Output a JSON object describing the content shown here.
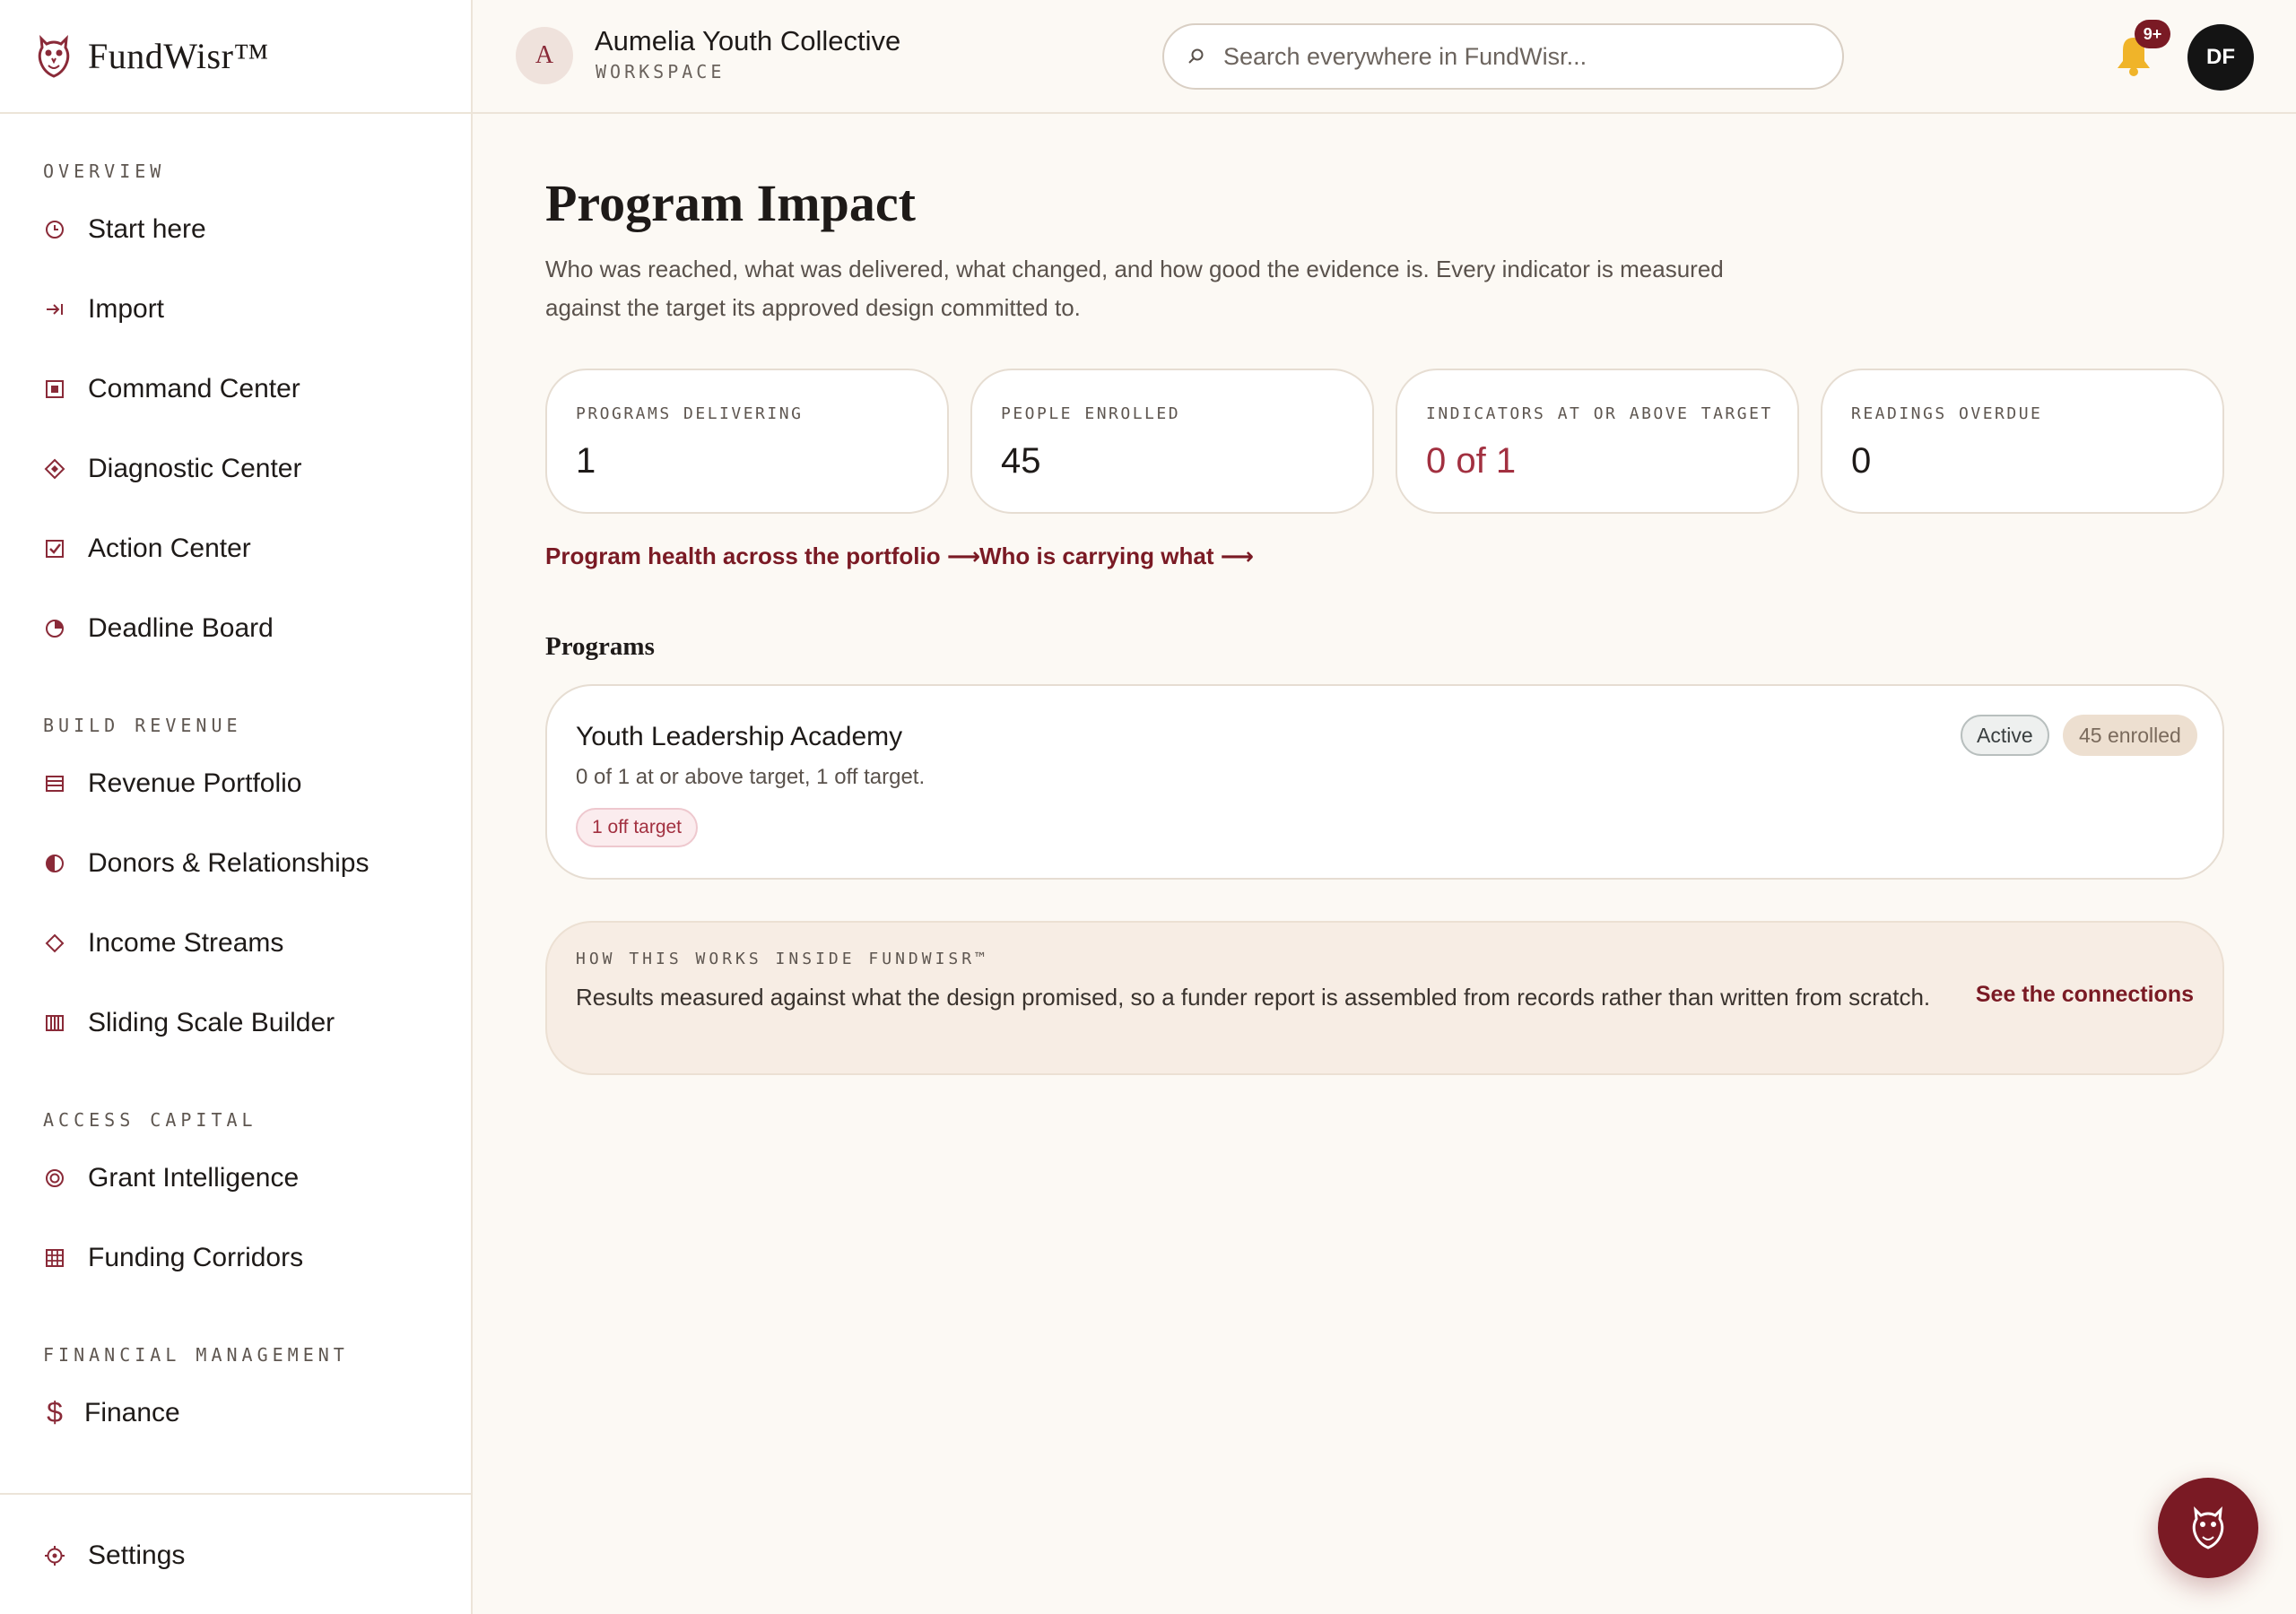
{
  "brand": {
    "name": "FundWisr™"
  },
  "sidebar": {
    "sections": [
      {
        "title": "OVERVIEW",
        "items": [
          {
            "label": "Start here"
          },
          {
            "label": "Import"
          },
          {
            "label": "Command Center"
          },
          {
            "label": "Diagnostic Center"
          },
          {
            "label": "Action Center"
          },
          {
            "label": "Deadline Board"
          }
        ]
      },
      {
        "title": "BUILD REVENUE",
        "items": [
          {
            "label": "Revenue Portfolio"
          },
          {
            "label": "Donors & Relationships"
          },
          {
            "label": "Income Streams"
          },
          {
            "label": "Sliding Scale Builder"
          }
        ]
      },
      {
        "title": "ACCESS CAPITAL",
        "items": [
          {
            "label": "Grant Intelligence"
          },
          {
            "label": "Funding Corridors"
          }
        ]
      },
      {
        "title": "FINANCIAL MANAGEMENT",
        "items": [
          {
            "label": "Finance"
          }
        ]
      }
    ],
    "settings_label": "Settings"
  },
  "header": {
    "workspace_initial": "A",
    "workspace_name": "Aumelia Youth Collective",
    "workspace_sub": "WORKSPACE",
    "search_placeholder": "Search everywhere in FundWisr...",
    "notification_count": "9+",
    "user_initials": "DF"
  },
  "page": {
    "title": "Program Impact",
    "description": "Who was reached, what was delivered, what changed, and how good the evidence is. Every indicator is measured against the target its approved design committed to.",
    "stats": [
      {
        "label": "PROGRAMS DELIVERING",
        "value": "1"
      },
      {
        "label": "PEOPLE ENROLLED",
        "value": "45"
      },
      {
        "label": "INDICATORS AT OR ABOVE TARGET",
        "value": "0 of 1"
      },
      {
        "label": "READINGS OVERDUE",
        "value": "0"
      }
    ],
    "links": {
      "portfolio": "Program health across the portfolio ⟶",
      "carrying": "Who is carrying what ⟶"
    },
    "programs_heading": "Programs",
    "program": {
      "name": "Youth Leadership Academy",
      "summary": "0 of 1 at or above target, 1 off target.",
      "chip": "1 off target",
      "status": "Active",
      "enrolled": "45 enrolled"
    },
    "info": {
      "label": "HOW THIS WORKS INSIDE FUNDWISR™",
      "text": "Results measured against what the design promised, so a funder report is assembled from records rather than written from scratch.",
      "link": "See the connections"
    }
  },
  "colors": {
    "accent": "#7a1a24",
    "alert": "#a23040",
    "background": "#fcf9f4"
  }
}
